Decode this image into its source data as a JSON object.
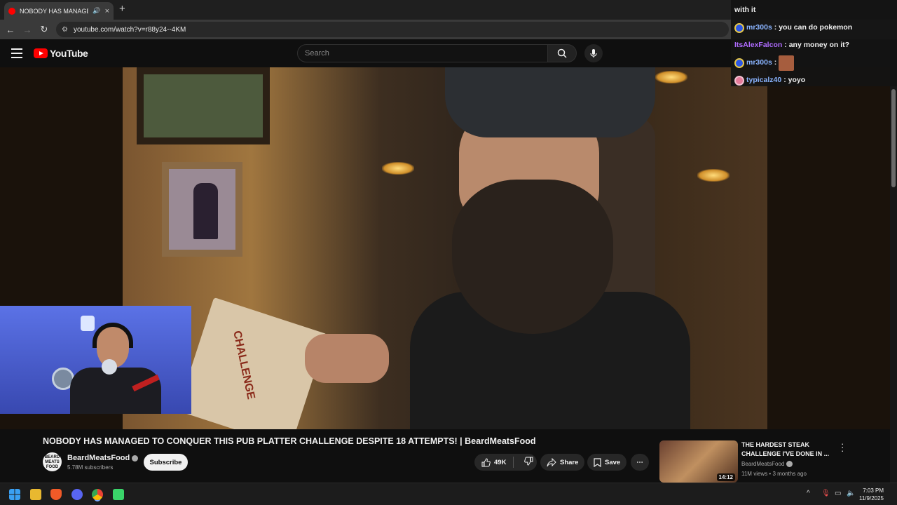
{
  "browser": {
    "tab_title": "NOBODY HAS MANAGED T",
    "url": "youtube.com/watch?v=r88y24--4KM",
    "new_tab": "+",
    "tab_close": "×"
  },
  "youtube": {
    "logo_text": "YouTube",
    "search_placeholder": "Search"
  },
  "chat": {
    "messages": [
      {
        "user": "",
        "text": "with it",
        "color": "#ffffff"
      },
      {
        "user": "mr300s",
        "text": ": you can do pokemon",
        "color": "#8ab4ff"
      },
      {
        "user": "ItsAlexFalcon",
        "text": ": any money on it?",
        "color": "#b06cff"
      },
      {
        "user": "mr300s",
        "text": ":",
        "color": "#8ab4ff"
      },
      {
        "user": "typicalz40",
        "text": ": yoyo",
        "color": "#8ab4ff"
      }
    ]
  },
  "video": {
    "title": "NOBODY HAS MANAGED TO CONQUER THIS PUB PLATTER CHALLENGE DESPITE 18 ATTEMPTS! | BeardMeatsFood",
    "paper_text": "CHALLENGE"
  },
  "channel": {
    "name": "BeardMeatsFood",
    "subscribers": "5.78M subscribers",
    "avatar_text": "BEARD MEATS FOOD",
    "subscribe_label": "Subscribe"
  },
  "actions": {
    "likes": "49K",
    "share_label": "Share",
    "save_label": "Save",
    "more": "⋯"
  },
  "related": {
    "title": "THE HARDEST STEAK CHALLENGE I'VE DONE IN ...",
    "channel": "BeardMeatsFood",
    "meta": "11M views • 3 months ago",
    "duration": "14:12"
  },
  "taskbar": {
    "time": "7:03 PM",
    "date": "11/9/2025"
  }
}
